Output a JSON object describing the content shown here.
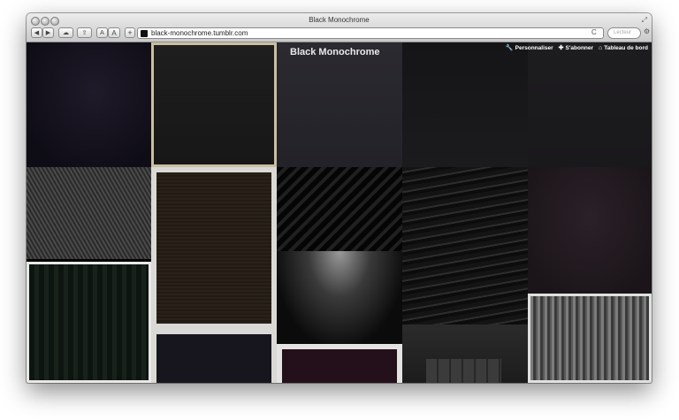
{
  "window": {
    "title": "Black Monochrome"
  },
  "toolbar": {
    "back_icon": "◀",
    "forward_icon": "▶",
    "icloud_icon": "☁",
    "share_icon": "⇪",
    "font_small": "A",
    "font_large": "A",
    "new_tab_icon": "+"
  },
  "address_bar": {
    "url": "black-monochrome.tumblr.com",
    "reload_icon": "C"
  },
  "search": {
    "placeholder": "Lecteur"
  },
  "blog": {
    "title": "Black Monochrome",
    "nav": [
      {
        "icon": "🔧",
        "label": "Personnaliser"
      },
      {
        "icon": "✚",
        "label": "S'abonner"
      },
      {
        "icon": "⌂",
        "label": "Tableau de bord"
      }
    ]
  }
}
